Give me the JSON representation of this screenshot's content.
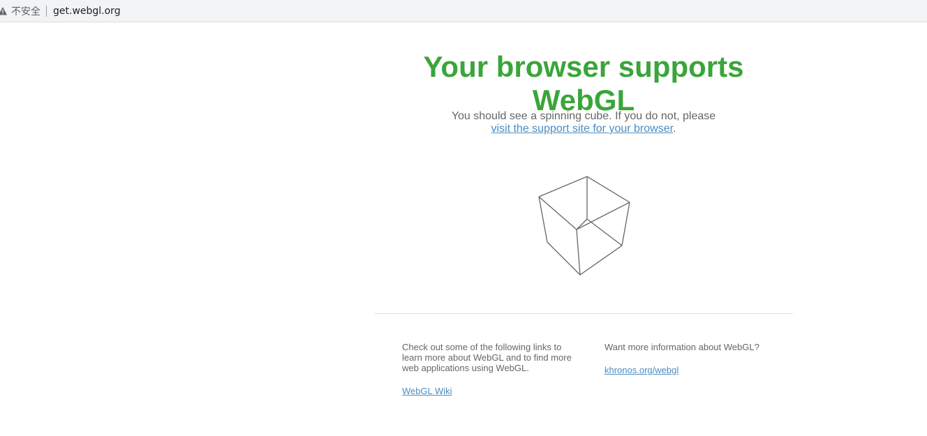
{
  "browser": {
    "security_label": "不安全",
    "url": "get.webgl.org"
  },
  "page": {
    "title": "Your browser supports WebGL",
    "intro_text": "You should see a spinning cube. If you do not, please",
    "intro_link": "visit the support site for your browser",
    "intro_suffix": ".",
    "left_text": "Check out some of the following links to learn more about WebGL and to find more web applications using WebGL.",
    "left_link": "WebGL Wiki",
    "right_text": "Want more information about WebGL?",
    "right_link": "khronos.org/webgl"
  },
  "colors": {
    "title": "#3aa53a",
    "link": "#4a8cc2",
    "text": "#666666",
    "cube_stroke": "#666666"
  }
}
